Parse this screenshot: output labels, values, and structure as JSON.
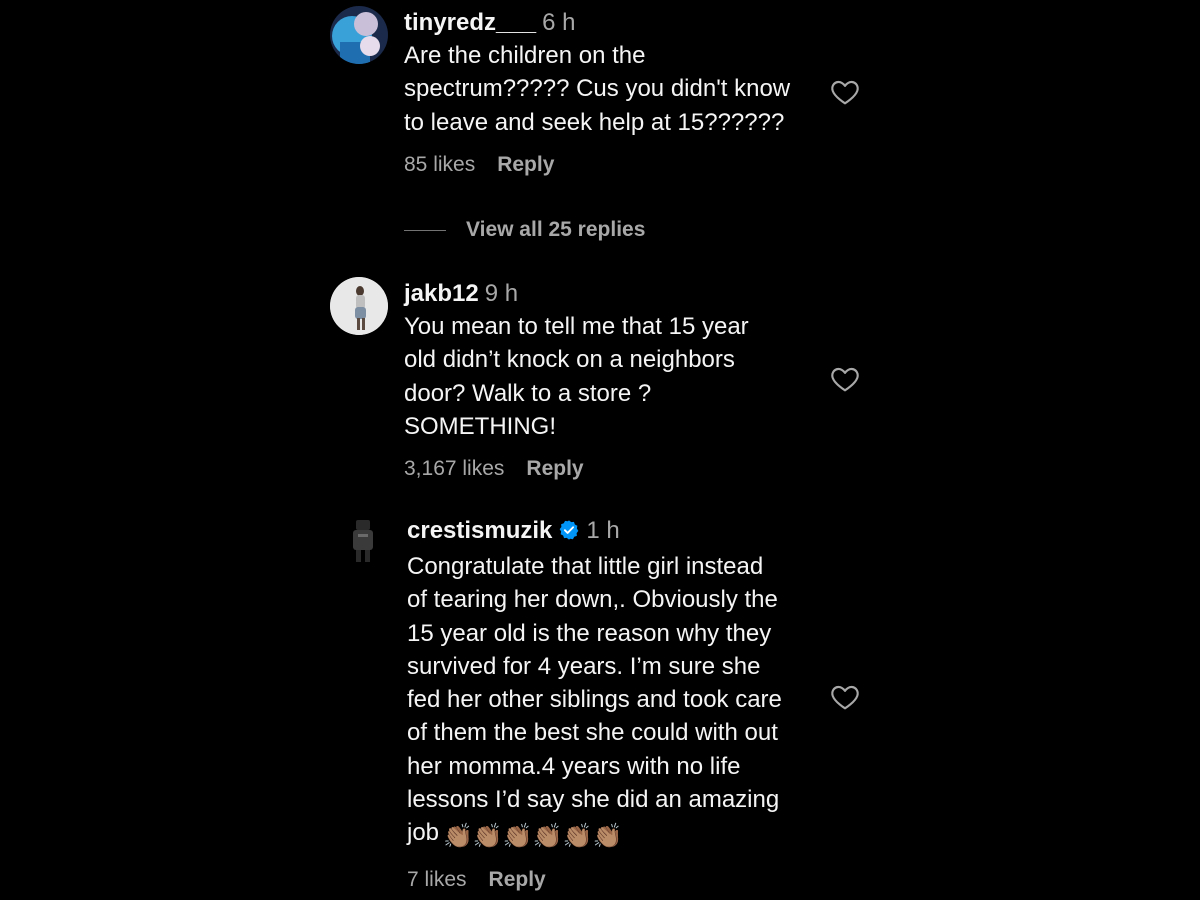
{
  "comments": [
    {
      "username": "tinyredz___",
      "time": "6 h",
      "text": "Are the children on the\nspectrum????? Cus you didn't know\nto leave and seek help at 15??????",
      "likes": "85 likes",
      "reply": "Reply",
      "view_replies": "View all 25 replies"
    },
    {
      "username": "jakb12",
      "time": "9 h",
      "text": "You mean to tell me that 15 year\nold didn’t knock on a neighbors\ndoor? Walk to a store ?\nSOMETHING!",
      "likes": "3,167 likes",
      "reply": "Reply"
    },
    {
      "username": "crestismuzik",
      "verified": true,
      "time": "1 h",
      "text": "Congratulate that little girl instead\nof tearing her down,. Obviously the\n15 year old is the reason why they\nsurvived for 4 years. I’m sure she\nfed her other siblings and took care\nof them the best she could with out\nher momma.4 years with no life\nlessons I’d say she did an amazing\njob",
      "emoji": "👏🏽👏🏽👏🏽👏🏽👏🏽👏🏽",
      "likes": "7 likes",
      "reply": "Reply"
    }
  ],
  "colors": {
    "background": "#000000",
    "primary_text": "#f5f5f5",
    "secondary_text": "#a8a8a8",
    "verified_blue": "#0095f6"
  }
}
